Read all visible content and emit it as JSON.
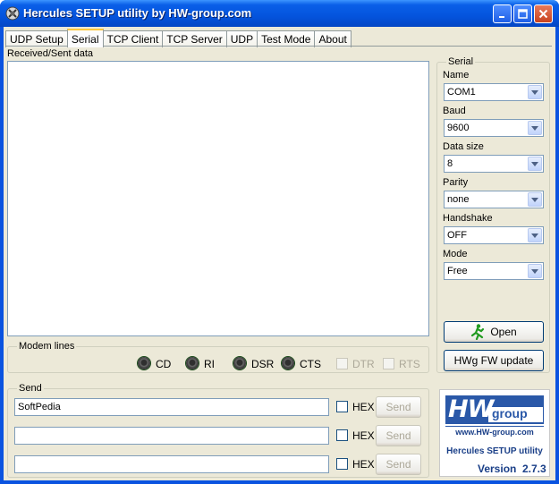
{
  "window": {
    "title": "Hercules SETUP utility by HW-group.com",
    "controls": {
      "minimize": "minimize-icon",
      "maximize": "maximize-icon",
      "close": "close-icon"
    }
  },
  "tabs": [
    {
      "label": "UDP Setup",
      "active": false
    },
    {
      "label": "Serial",
      "active": true
    },
    {
      "label": "TCP Client",
      "active": false
    },
    {
      "label": "TCP Server",
      "active": false
    },
    {
      "label": "UDP",
      "active": false
    },
    {
      "label": "Test Mode",
      "active": false
    },
    {
      "label": "About",
      "active": false
    }
  ],
  "received": {
    "label": "Received/Sent data",
    "content": ""
  },
  "serial": {
    "title": "Serial",
    "fields": [
      {
        "label": "Name",
        "value": "COM1"
      },
      {
        "label": "Baud",
        "value": "9600"
      },
      {
        "label": "Data size",
        "value": "8"
      },
      {
        "label": "Parity",
        "value": "none"
      },
      {
        "label": "Handshake",
        "value": "OFF"
      },
      {
        "label": "Mode",
        "value": "Free"
      }
    ],
    "open_button": "Open",
    "fw_button": "HWg FW update"
  },
  "modem": {
    "title": "Modem lines",
    "leds": [
      "CD",
      "RI",
      "DSR",
      "CTS"
    ],
    "checks": [
      "DTR",
      "RTS"
    ]
  },
  "send": {
    "title": "Send",
    "rows": [
      {
        "value": "SoftPedia",
        "hex_label": "HEX",
        "button": "Send"
      },
      {
        "value": "",
        "hex_label": "HEX",
        "button": "Send"
      },
      {
        "value": "",
        "hex_label": "HEX",
        "button": "Send"
      }
    ]
  },
  "logo": {
    "brand": "HW",
    "brand_suffix": "group",
    "url": "www.HW-group.com",
    "product": "Hercules SETUP utility",
    "version_label": "Version",
    "version": "2.7.3"
  },
  "colors": {
    "title_bar": "#0454dd",
    "dialog_bg": "#ece9d8",
    "tab_highlight": "#ffc83c",
    "logo_blue": "#2a58a8",
    "led_ring": "#1b4d1b"
  }
}
